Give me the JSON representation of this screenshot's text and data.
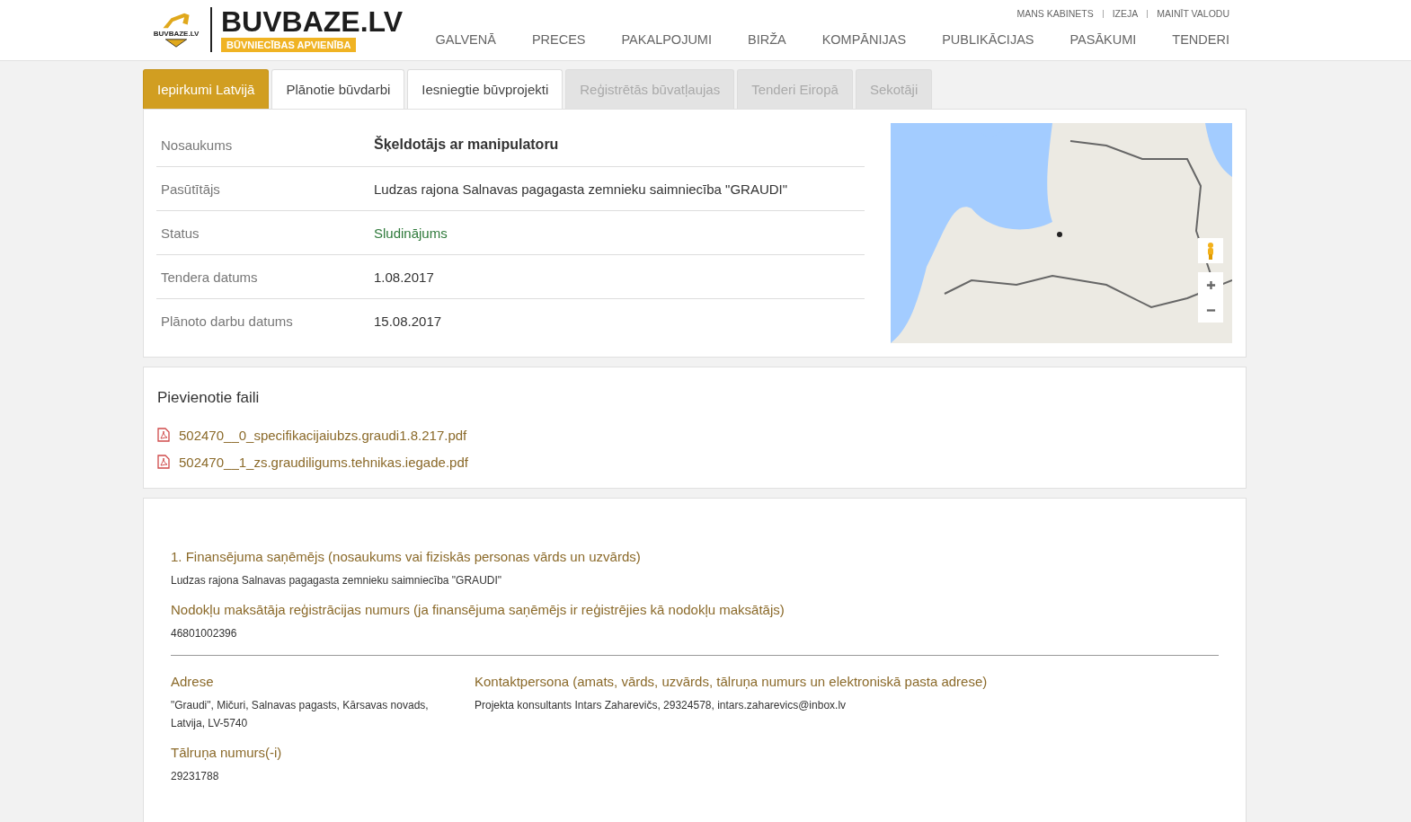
{
  "header": {
    "logo": {
      "badge": "BUVBAZE.LV",
      "title": "BUVBAZE.LV",
      "subtitle": "BŪVNIECĪBAS APVIENĪBA"
    },
    "top_links": [
      "MANS KABINETS",
      "IZEJA",
      "MAINĪT VALODU"
    ],
    "nav": [
      "GALVENĀ",
      "PRECES",
      "PAKALPOJUMI",
      "BIRŽA",
      "KOMPĀNIJAS",
      "PUBLIKĀCIJAS",
      "PASĀKUMI",
      "TENDERI"
    ]
  },
  "tabs": [
    {
      "label": "Iepirkumi Latvijā",
      "selected": true,
      "disabled": false
    },
    {
      "label": "Plānotie būvdarbi",
      "selected": false,
      "disabled": false
    },
    {
      "label": "Iesniegtie būvprojekti",
      "selected": false,
      "disabled": false
    },
    {
      "label": "Reģistrētās būvatļaujas",
      "selected": false,
      "disabled": true
    },
    {
      "label": "Tenderi Eiropā",
      "selected": false,
      "disabled": true
    },
    {
      "label": "Sekotāji",
      "selected": false,
      "disabled": true
    }
  ],
  "info": [
    {
      "label": "Nosaukums",
      "value": "Šķeldotājs ar manipulatoru",
      "kind": "title"
    },
    {
      "label": "Pasūtītājs",
      "value": "Ludzas rajona Salnavas pagagasta zemnieku saimniecība \"GRAUDI\"",
      "kind": "text"
    },
    {
      "label": "Status",
      "value": "Sludinājums",
      "kind": "status"
    },
    {
      "label": "Tendera datums",
      "value": "1.08.2017",
      "kind": "text"
    },
    {
      "label": "Plānoto darbu datums",
      "value": "15.08.2017",
      "kind": "text"
    }
  ],
  "files": {
    "title": "Pievienotie faili",
    "items": [
      "502470__0_specifikacijaiubzs.graudi1.8.217.pdf",
      "502470__1_zs.graudiligums.tehnikas.iegade.pdf"
    ]
  },
  "details": {
    "top": [
      {
        "label": "1. Finansējuma saņēmējs (nosaukums vai fiziskās personas vārds un uzvārds)",
        "value": "Ludzas rajona Salnavas pagagasta zemnieku saimniecība \"GRAUDI\""
      },
      {
        "label": "Nodokļu maksātāja reģistrācijas numurs (ja finansējuma saņēmējs ir reģistrējies kā nodokļu maksātājs)",
        "value": "46801002396"
      }
    ],
    "left": [
      {
        "label": "Adrese",
        "value": "\"Graudi\", Mičuri, Salnavas pagasts, Kārsavas novads, Latvija, LV-5740"
      },
      {
        "label": "Tālruņa numurs(-i)",
        "value": "29231788"
      }
    ],
    "right": [
      {
        "label": "Kontaktpersona (amats, vārds, uzvārds, tālruņa numurs un elektroniskā pasta adrese)",
        "value": "Projekta konsultants Intars Zaharevičs, 29324578, intars.zaharevics@inbox.lv"
      }
    ]
  }
}
